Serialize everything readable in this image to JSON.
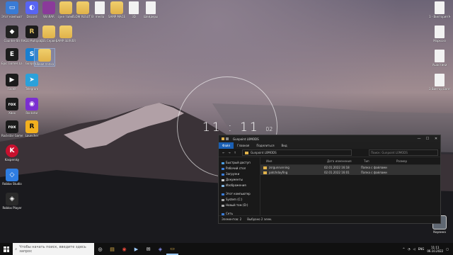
{
  "desktop": {
    "icons_left": [
      {
        "label": "Этот компьютер",
        "bg": "#3a7bd5",
        "glyph": "▭"
      },
      {
        "label": "Discord",
        "bg": "#5865f2",
        "glyph": "◐"
      },
      {
        "label": "Counter-Str",
        "bg": "#222222",
        "glyph": "◆"
      },
      {
        "label": "RAGE Multiplayer",
        "bg": "#1b1b1b",
        "glyph": "R"
      },
      {
        "label": "Epic Games Launcher",
        "bg": "#1c1c1c",
        "glyph": "E"
      },
      {
        "label": "Gunpoint",
        "bg": "#1a7fd0",
        "glyph": "S"
      },
      {
        "label": "Faceit",
        "bg": "#1b1b1b",
        "glyph": "▶"
      },
      {
        "label": "Telegram",
        "bg": "#2aa1da",
        "glyph": "➤"
      },
      {
        "label": "Xbox",
        "bg": "#1b1b1b",
        "glyph": "rox"
      },
      {
        "label": "Rockstar",
        "bg": "#7b2fd0",
        "glyph": "◉"
      },
      {
        "label": "Rockstar Games",
        "bg": "#1b1b1b",
        "glyph": "rox"
      },
      {
        "label": "Launcher",
        "bg": "#f2b01e",
        "glyph": "R"
      },
      {
        "label": "Kaspersky",
        "bg": "#c8102e",
        "glyph": "K"
      },
      {
        "label": "Roblox Studio",
        "bg": "#2f7de1",
        "glyph": "◇"
      },
      {
        "label": "Roblox Player",
        "bg": "#2a2a2a",
        "glyph": "◈"
      }
    ],
    "icons_top": [
      {
        "label": "WinRAR",
        "kind": "folder"
      },
      {
        "label": "суке тайкс",
        "kind": "folder"
      },
      {
        "label": "FLOW RESUT BARRETT",
        "kind": "folder"
      },
      {
        "label": "media",
        "kind": "file"
      },
      {
        "label": "SAMP МАСЕ",
        "kind": "folder"
      },
      {
        "label": "3D",
        "kind": "file"
      },
      {
        "label": "Шейдеры",
        "kind": "file"
      }
    ],
    "icons_mid": [
      {
        "label": "CSS Сервер",
        "kind": "folder"
      },
      {
        "label": "SAMP SERVER",
        "kind": "folder"
      },
      {
        "label": "Новая папка",
        "kind": "folder"
      }
    ],
    "icons_right": [
      {
        "label": "1 - Виктория Марупика",
        "kind": "file"
      },
      {
        "label": "Марксиз",
        "kind": "file"
      },
      {
        "label": "Ушастики",
        "kind": "file"
      },
      {
        "label": "3 Виктор Ваплаевц",
        "kind": "file"
      },
      {
        "label": "Корзина",
        "kind": "bin"
      }
    ]
  },
  "clock": {
    "time": "11 : 11",
    "seconds": "02"
  },
  "explorer": {
    "title": "Gunpoint L0MODS",
    "window_controls": [
      "—",
      "☐",
      "✕"
    ],
    "tabs": [
      "Файл",
      "Главная",
      "Поделиться",
      "Вид"
    ],
    "address": "Gunpoint L0MODS",
    "search_placeholder": "Поиск: Gunpoint L0MODS",
    "nav_items": [
      {
        "label": "Быстрый доступ",
        "color": "#4a9de0"
      },
      {
        "label": "Рабочий стол",
        "color": "#3a7bd5"
      },
      {
        "label": "Загрузки",
        "color": "#3a7bd5"
      },
      {
        "label": "Документы",
        "color": "#cccccc"
      },
      {
        "label": "Изображения",
        "color": "#7fb3e0"
      }
    ],
    "nav_items2": [
      {
        "label": "Этот компьютер",
        "color": "#3a7bd5"
      },
      {
        "label": "System (C:)",
        "color": "#aaaaaa"
      },
      {
        "label": "Новый том (D:)",
        "color": "#aaaaaa"
      }
    ],
    "nav_items3": [
      {
        "label": "Сеть",
        "color": "#3a7bd5"
      }
    ],
    "columns": [
      "Имя",
      "Дата изменения",
      "Тип",
      "Размер"
    ],
    "rows": [
      {
        "name": "zsrgunrunning",
        "date": "02.01.2022 16:18",
        "type": "Папка с файлами",
        "size": ""
      },
      {
        "name": "patchdayfing",
        "date": "02.01.2022 16:01",
        "type": "Папка с файлами",
        "size": ""
      }
    ],
    "status_count": "Элементов: 2",
    "status_selected": "Выбрано 2 элем."
  },
  "taskbar": {
    "search_placeholder": "Чтобы начать поиск, введите здесь запрос",
    "apps": [
      {
        "glyph": "◎"
      },
      {
        "glyph": "▤"
      },
      {
        "glyph": "◉"
      },
      {
        "glyph": "▶"
      },
      {
        "glyph": "✉"
      },
      {
        "glyph": "◈"
      },
      {
        "glyph": "▭",
        "active": true
      }
    ],
    "tray_lang": "ENG",
    "time": "11:11",
    "date": "06.10.2022"
  }
}
